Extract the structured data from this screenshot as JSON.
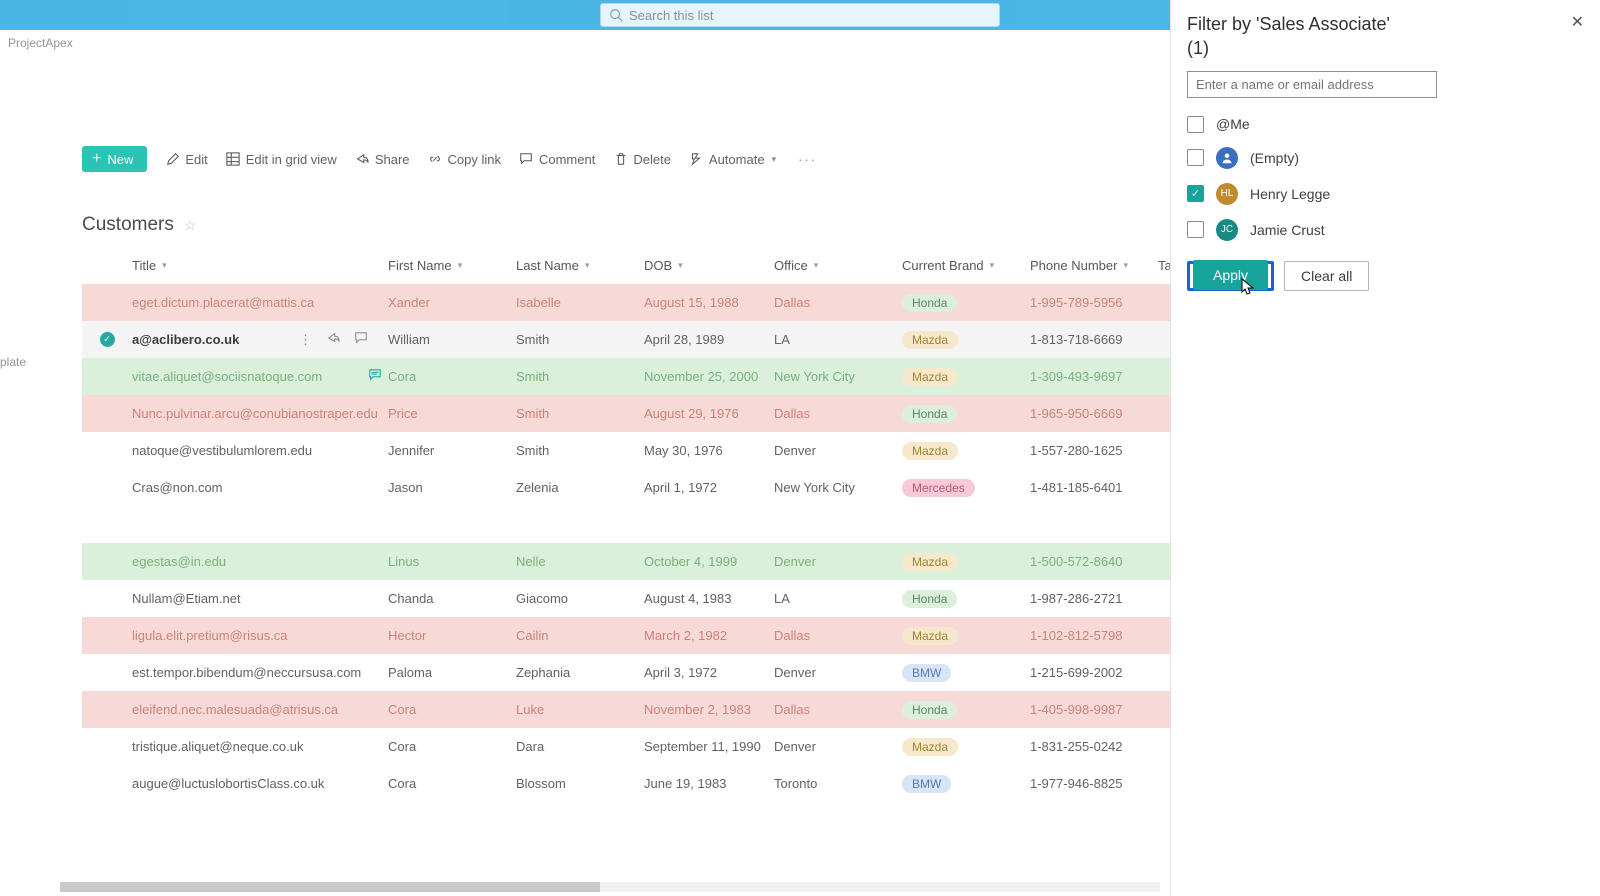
{
  "topbar": {
    "search_placeholder": "Search this list"
  },
  "breadcrumb": "ProjectApex",
  "left_sliver_label": "plate",
  "commandbar": {
    "new": "New",
    "edit": "Edit",
    "grid": "Edit in grid view",
    "share": "Share",
    "copylink": "Copy link",
    "comment": "Comment",
    "delete": "Delete",
    "automate": "Automate"
  },
  "list": {
    "title": "Customers"
  },
  "columns": {
    "title": "Title",
    "first": "First Name",
    "last": "Last Name",
    "dob": "DOB",
    "office": "Office",
    "brand": "Current Brand",
    "phone": "Phone Number",
    "tail": "Ta"
  },
  "rows": [
    {
      "tone": "red",
      "title": "eget.dictum.placerat@mattis.ca",
      "first": "Xander",
      "last": "Isabelle",
      "dob": "August 15, 1988",
      "office": "Dallas",
      "brand": "Honda",
      "brand_style": "honda",
      "phone": "1-995-789-5956"
    },
    {
      "tone": "sel",
      "title": "a@aclibero.co.uk",
      "first": "William",
      "last": "Smith",
      "dob": "April 28, 1989",
      "office": "LA",
      "brand": "Mazda",
      "brand_style": "mazda",
      "phone": "1-813-718-6669",
      "selected": true,
      "actions": true
    },
    {
      "tone": "green",
      "title": "vitae.aliquet@sociisnatoque.com",
      "first": "Cora",
      "last": "Smith",
      "dob": "November 25, 2000",
      "office": "New York City",
      "brand": "Mazda",
      "brand_style": "mazda",
      "phone": "1-309-493-9697",
      "has_comment": true
    },
    {
      "tone": "red",
      "title": "Nunc.pulvinar.arcu@conubianostraper.edu",
      "first": "Price",
      "last": "Smith",
      "dob": "August 29, 1976",
      "office": "Dallas",
      "brand": "Honda",
      "brand_style": "honda",
      "phone": "1-965-950-6669"
    },
    {
      "tone": "",
      "title": "natoque@vestibulumlorem.edu",
      "first": "Jennifer",
      "last": "Smith",
      "dob": "May 30, 1976",
      "office": "Denver",
      "brand": "Mazda",
      "brand_style": "mazda",
      "phone": "1-557-280-1625"
    },
    {
      "tone": "",
      "title": "Cras@non.com",
      "first": "Jason",
      "last": "Zelenia",
      "dob": "April 1, 1972",
      "office": "New York City",
      "brand": "Mercedes",
      "brand_style": "mercedes",
      "phone": "1-481-185-6401"
    },
    {
      "blank": true
    },
    {
      "tone": "green",
      "title": "egestas@in.edu",
      "first": "Linus",
      "last": "Nelle",
      "dob": "October 4, 1999",
      "office": "Denver",
      "brand": "Mazda",
      "brand_style": "mazda",
      "phone": "1-500-572-8640"
    },
    {
      "tone": "",
      "title": "Nullam@Etiam.net",
      "first": "Chanda",
      "last": "Giacomo",
      "dob": "August 4, 1983",
      "office": "LA",
      "brand": "Honda",
      "brand_style": "honda",
      "phone": "1-987-286-2721"
    },
    {
      "tone": "red",
      "title": "ligula.elit.pretium@risus.ca",
      "first": "Hector",
      "last": "Cailin",
      "dob": "March 2, 1982",
      "office": "Dallas",
      "brand": "Mazda",
      "brand_style": "mazda",
      "phone": "1-102-812-5798"
    },
    {
      "tone": "",
      "title": "est.tempor.bibendum@neccursusa.com",
      "first": "Paloma",
      "last": "Zephania",
      "dob": "April 3, 1972",
      "office": "Denver",
      "brand": "BMW",
      "brand_style": "bmw",
      "phone": "1-215-699-2002"
    },
    {
      "tone": "red",
      "title": "eleifend.nec.malesuada@atrisus.ca",
      "first": "Cora",
      "last": "Luke",
      "dob": "November 2, 1983",
      "office": "Dallas",
      "brand": "Honda",
      "brand_style": "honda",
      "phone": "1-405-998-9987"
    },
    {
      "tone": "",
      "title": "tristique.aliquet@neque.co.uk",
      "first": "Cora",
      "last": "Dara",
      "dob": "September 11, 1990",
      "office": "Denver",
      "brand": "Mazda",
      "brand_style": "mazda",
      "phone": "1-831-255-0242"
    },
    {
      "tone": "",
      "title": "augue@luctuslobortisClass.co.uk",
      "first": "Cora",
      "last": "Blossom",
      "dob": "June 19, 1983",
      "office": "Toronto",
      "brand": "BMW",
      "brand_style": "bmw",
      "phone": "1-977-946-8825"
    }
  ],
  "filter": {
    "title_line1": "Filter by 'Sales Associate'",
    "title_line2": "(1)",
    "input_placeholder": "Enter a name or email address",
    "opt_me": "@Me",
    "opt_empty": "(Empty)",
    "opt_henry": "Henry Legge",
    "opt_jamie": "Jamie Crust",
    "initials_empty": "",
    "initials_henry": "HL",
    "initials_jamie": "JC",
    "apply": "Apply",
    "clear": "Clear all"
  }
}
